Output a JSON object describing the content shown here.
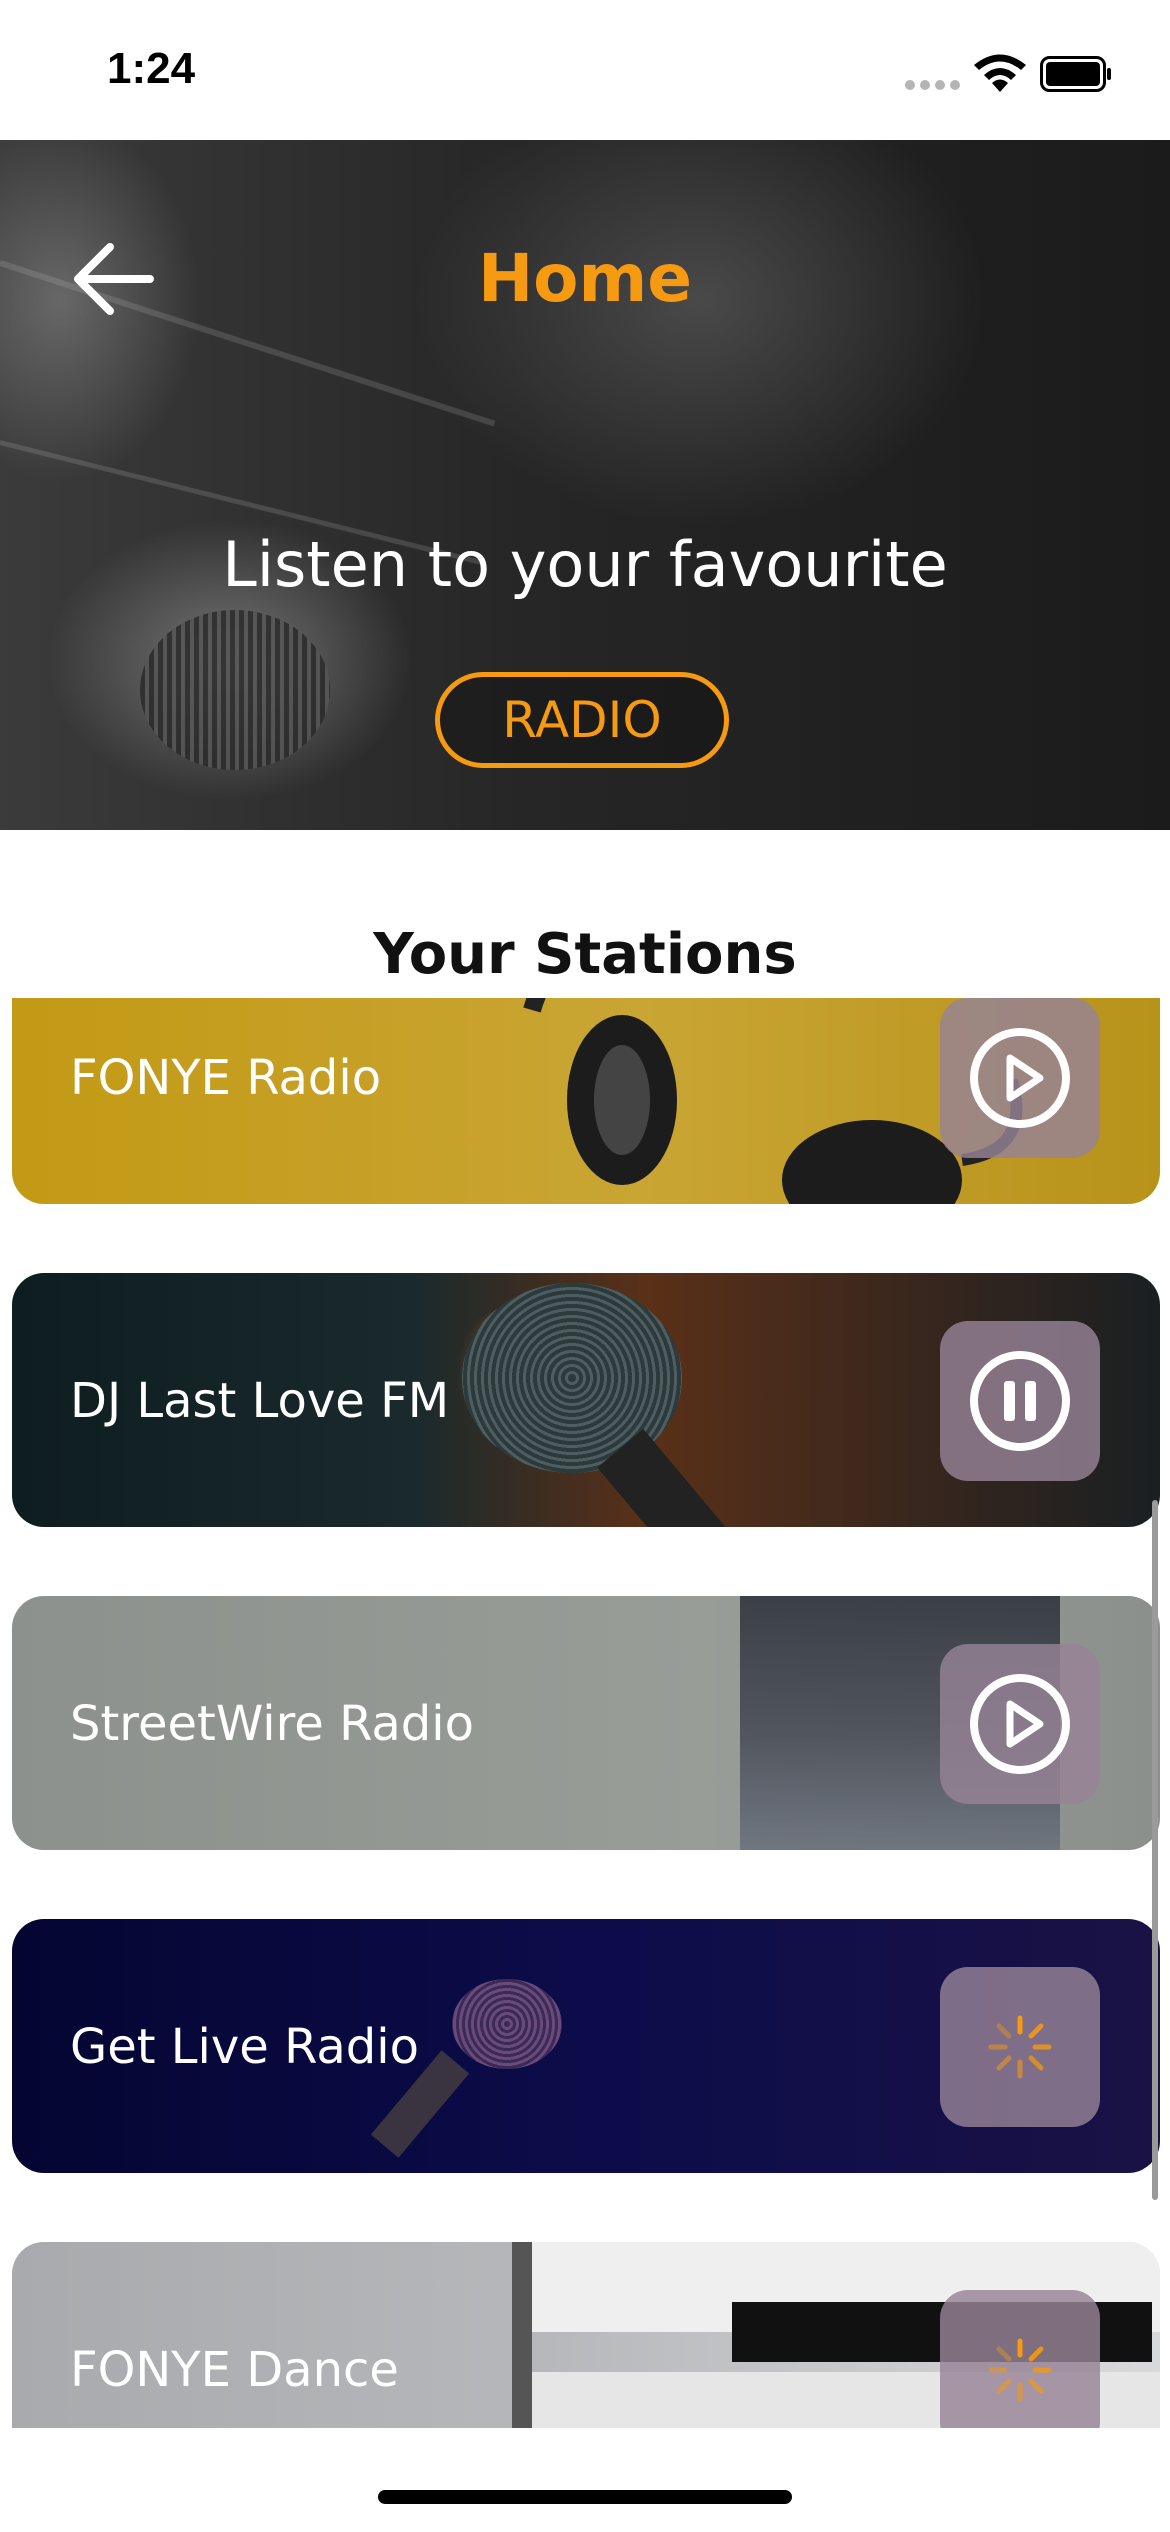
{
  "status_bar": {
    "time": "1:24"
  },
  "header": {
    "title": "Home",
    "tagline": "Listen to your favourite",
    "cta_label": "RADIO",
    "accent_color": "#f59a11"
  },
  "section": {
    "title": "Your Stations"
  },
  "stations": [
    {
      "name": "FONYE Radio",
      "state": "play",
      "icon": "play-icon"
    },
    {
      "name": "DJ Last Love FM",
      "state": "pause",
      "icon": "pause-icon"
    },
    {
      "name": "StreetWire Radio",
      "state": "play",
      "icon": "play-icon"
    },
    {
      "name": "Get Live Radio",
      "state": "loading",
      "icon": "loading-spinner-icon"
    },
    {
      "name": "FONYE Dance",
      "state": "loading",
      "icon": "loading-spinner-icon"
    }
  ]
}
